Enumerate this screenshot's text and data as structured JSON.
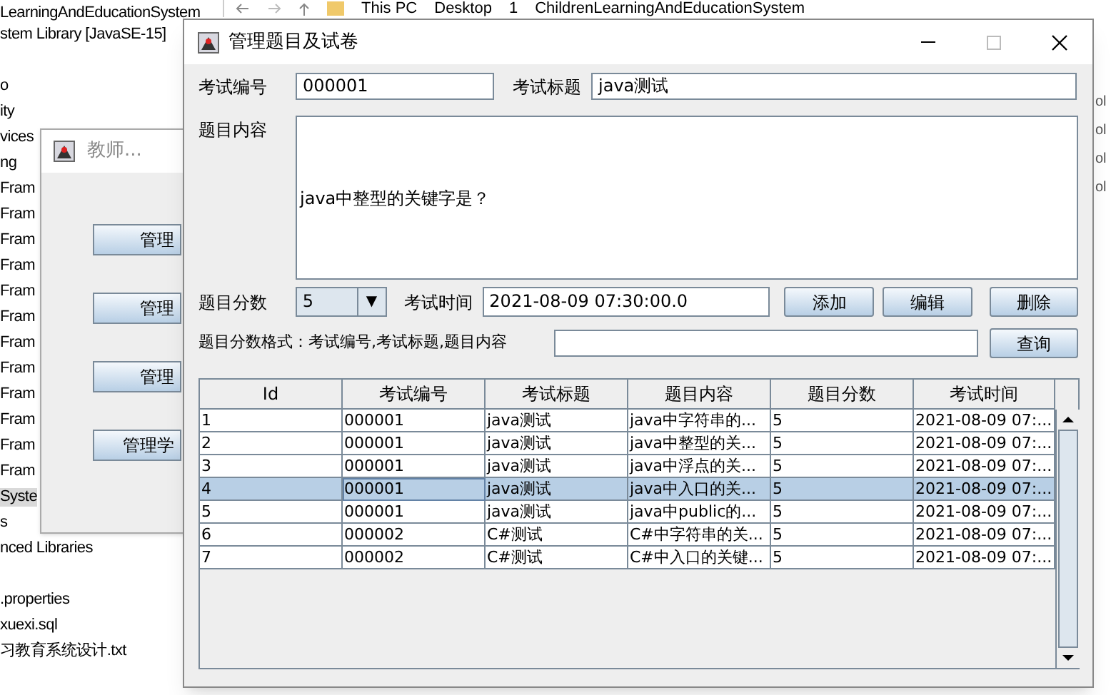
{
  "explorer_tree": [
    {
      "text": "LearningAndEducationSystem",
      "selected": false
    },
    {
      "text": "stem Library [JavaSE-15]",
      "selected": false
    },
    {
      "text": "o",
      "selected": false,
      "gap_before": true
    },
    {
      "text": "ity",
      "selected": false
    },
    {
      "text": "vices",
      "selected": false
    },
    {
      "text": "ng",
      "selected": false
    },
    {
      "text": "Fram",
      "selected": false
    },
    {
      "text": "Fram",
      "selected": false
    },
    {
      "text": "Fram",
      "selected": false
    },
    {
      "text": "Fram",
      "selected": false
    },
    {
      "text": "Fram",
      "selected": false
    },
    {
      "text": "Fram",
      "selected": false
    },
    {
      "text": "Fram",
      "selected": false
    },
    {
      "text": "Fram",
      "selected": false
    },
    {
      "text": "Fram",
      "selected": false
    },
    {
      "text": "Fram",
      "selected": false
    },
    {
      "text": "Fram",
      "selected": false
    },
    {
      "text": "Fram",
      "selected": false
    },
    {
      "text": "Syste",
      "selected": true
    },
    {
      "text": "s",
      "selected": false
    },
    {
      "text": "nced Libraries",
      "selected": false
    },
    {
      "text": ".properties",
      "selected": false,
      "gap_before": true
    },
    {
      "text": "xuexi.sql",
      "selected": false
    },
    {
      "text": "习教育系统设计.txt",
      "selected": false
    }
  ],
  "breadcrumb": [
    "This PC",
    "Desktop",
    "1",
    "ChildrenLearningAndEducationSystem"
  ],
  "right_edge_items": [
    "ol",
    "ol",
    "ol",
    "ol"
  ],
  "teacher_window": {
    "title": "教师...",
    "buttons": [
      "管理",
      "管理",
      "管理",
      "管理学"
    ]
  },
  "main_window": {
    "title": "管理题目及试卷",
    "exam_id": {
      "label": "考试编号",
      "value": "000001"
    },
    "exam_title": {
      "label": "考试标题",
      "value": "java测试"
    },
    "question_content": {
      "label": "题目内容",
      "value": "java中整型的关键字是？"
    },
    "score": {
      "label": "题目分数",
      "value": "5",
      "dropdown_arrow": "▼"
    },
    "exam_time": {
      "label": "考试时间",
      "value": "2021-08-09 07:30:00.0"
    },
    "buttons": [
      "添加",
      "编辑",
      "删除"
    ],
    "query": {
      "label": "题目分数格式：考试编号,考试标题,题目内容",
      "button": "查询"
    },
    "table": {
      "columns": [
        "Id",
        "考试编号",
        "考试标题",
        "题目内容",
        "题目分数",
        "考试时间"
      ],
      "rows": [
        {
          "cells": [
            "1",
            "000001",
            "java测试",
            "java中字符串的...",
            "5",
            "2021-08-09 07:..."
          ],
          "selected": false
        },
        {
          "cells": [
            "2",
            "000001",
            "java测试",
            "java中整型的关...",
            "5",
            "2021-08-09 07:..."
          ],
          "selected": false
        },
        {
          "cells": [
            "3",
            "000001",
            "java测试",
            "java中浮点的关...",
            "5",
            "2021-08-09 07:..."
          ],
          "selected": false
        },
        {
          "cells": [
            "4",
            "000001",
            "java测试",
            "java中入口的关...",
            "5",
            "2021-08-09 07:..."
          ],
          "selected": true
        },
        {
          "cells": [
            "5",
            "000001",
            "java测试",
            "java中public的...",
            "5",
            "2021-08-09 07:..."
          ],
          "selected": false
        },
        {
          "cells": [
            "6",
            "000002",
            "C#测试",
            "C#中字符串的关...",
            "5",
            "2021-08-09 07:..."
          ],
          "selected": false
        },
        {
          "cells": [
            "7",
            "000002",
            "C#测试",
            "C#中入口的关键...",
            "5",
            "2021-08-09 07:..."
          ],
          "selected": false
        }
      ]
    }
  }
}
